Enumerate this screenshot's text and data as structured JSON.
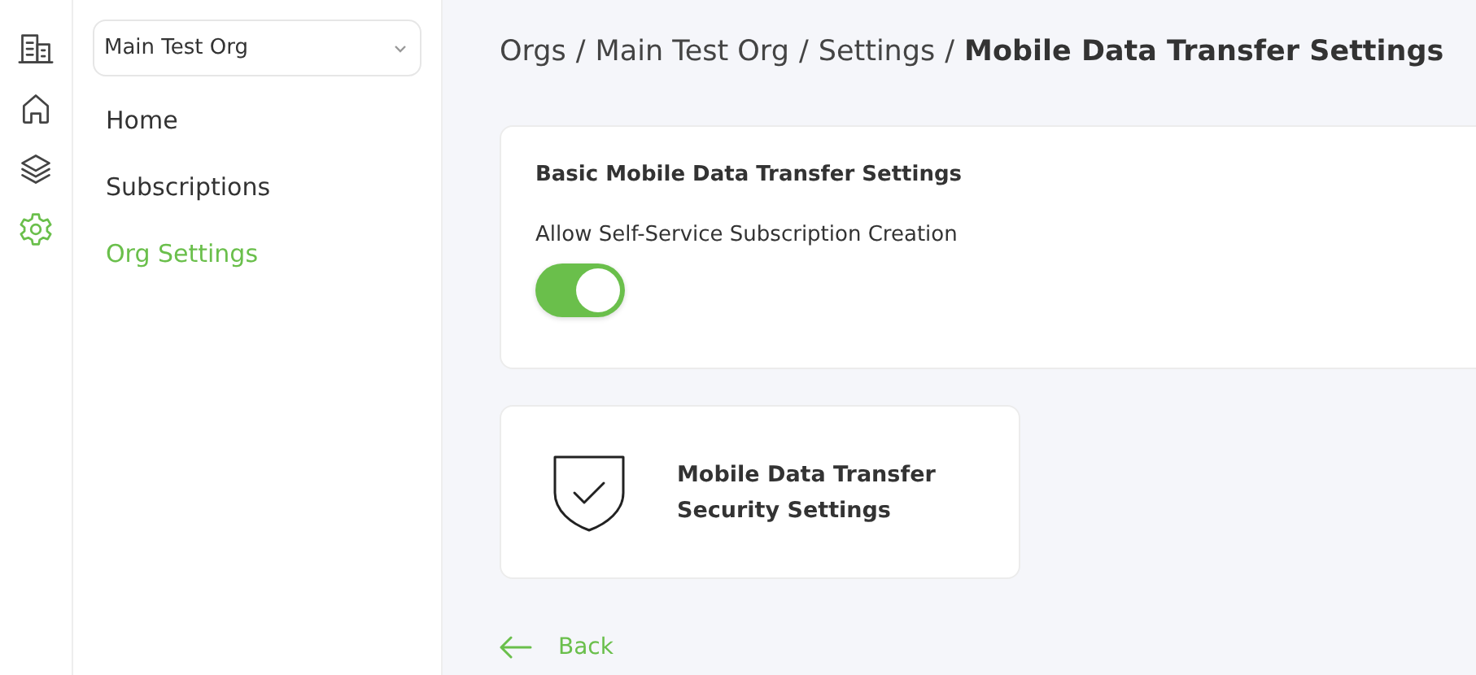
{
  "rail": [
    {
      "kind": "building",
      "selected": false
    },
    {
      "kind": "home",
      "selected": false
    },
    {
      "kind": "layers",
      "selected": false
    },
    {
      "kind": "settings",
      "selected": true
    }
  ],
  "org_select": {
    "value": "Main Test Org"
  },
  "nav": [
    {
      "label": "Home",
      "selected": false
    },
    {
      "label": "Subscriptions",
      "selected": false
    },
    {
      "label": "Org Settings",
      "selected": true
    }
  ],
  "breadcrumb": {
    "separator": "/",
    "items": [
      {
        "label": "Orgs",
        "current": false
      },
      {
        "label": "Main Test Org",
        "current": false
      },
      {
        "label": "Settings",
        "current": false
      },
      {
        "label": "Mobile Data Transfer Settings",
        "current": true
      }
    ]
  },
  "settings_card": {
    "title": "Basic Mobile Data Transfer Settings",
    "toggle": {
      "label": "Allow Self-Service Subscription Creation",
      "on": true
    }
  },
  "security_card": {
    "title": "Mobile Data Transfer Security Settings"
  },
  "back": {
    "label": "Back"
  }
}
